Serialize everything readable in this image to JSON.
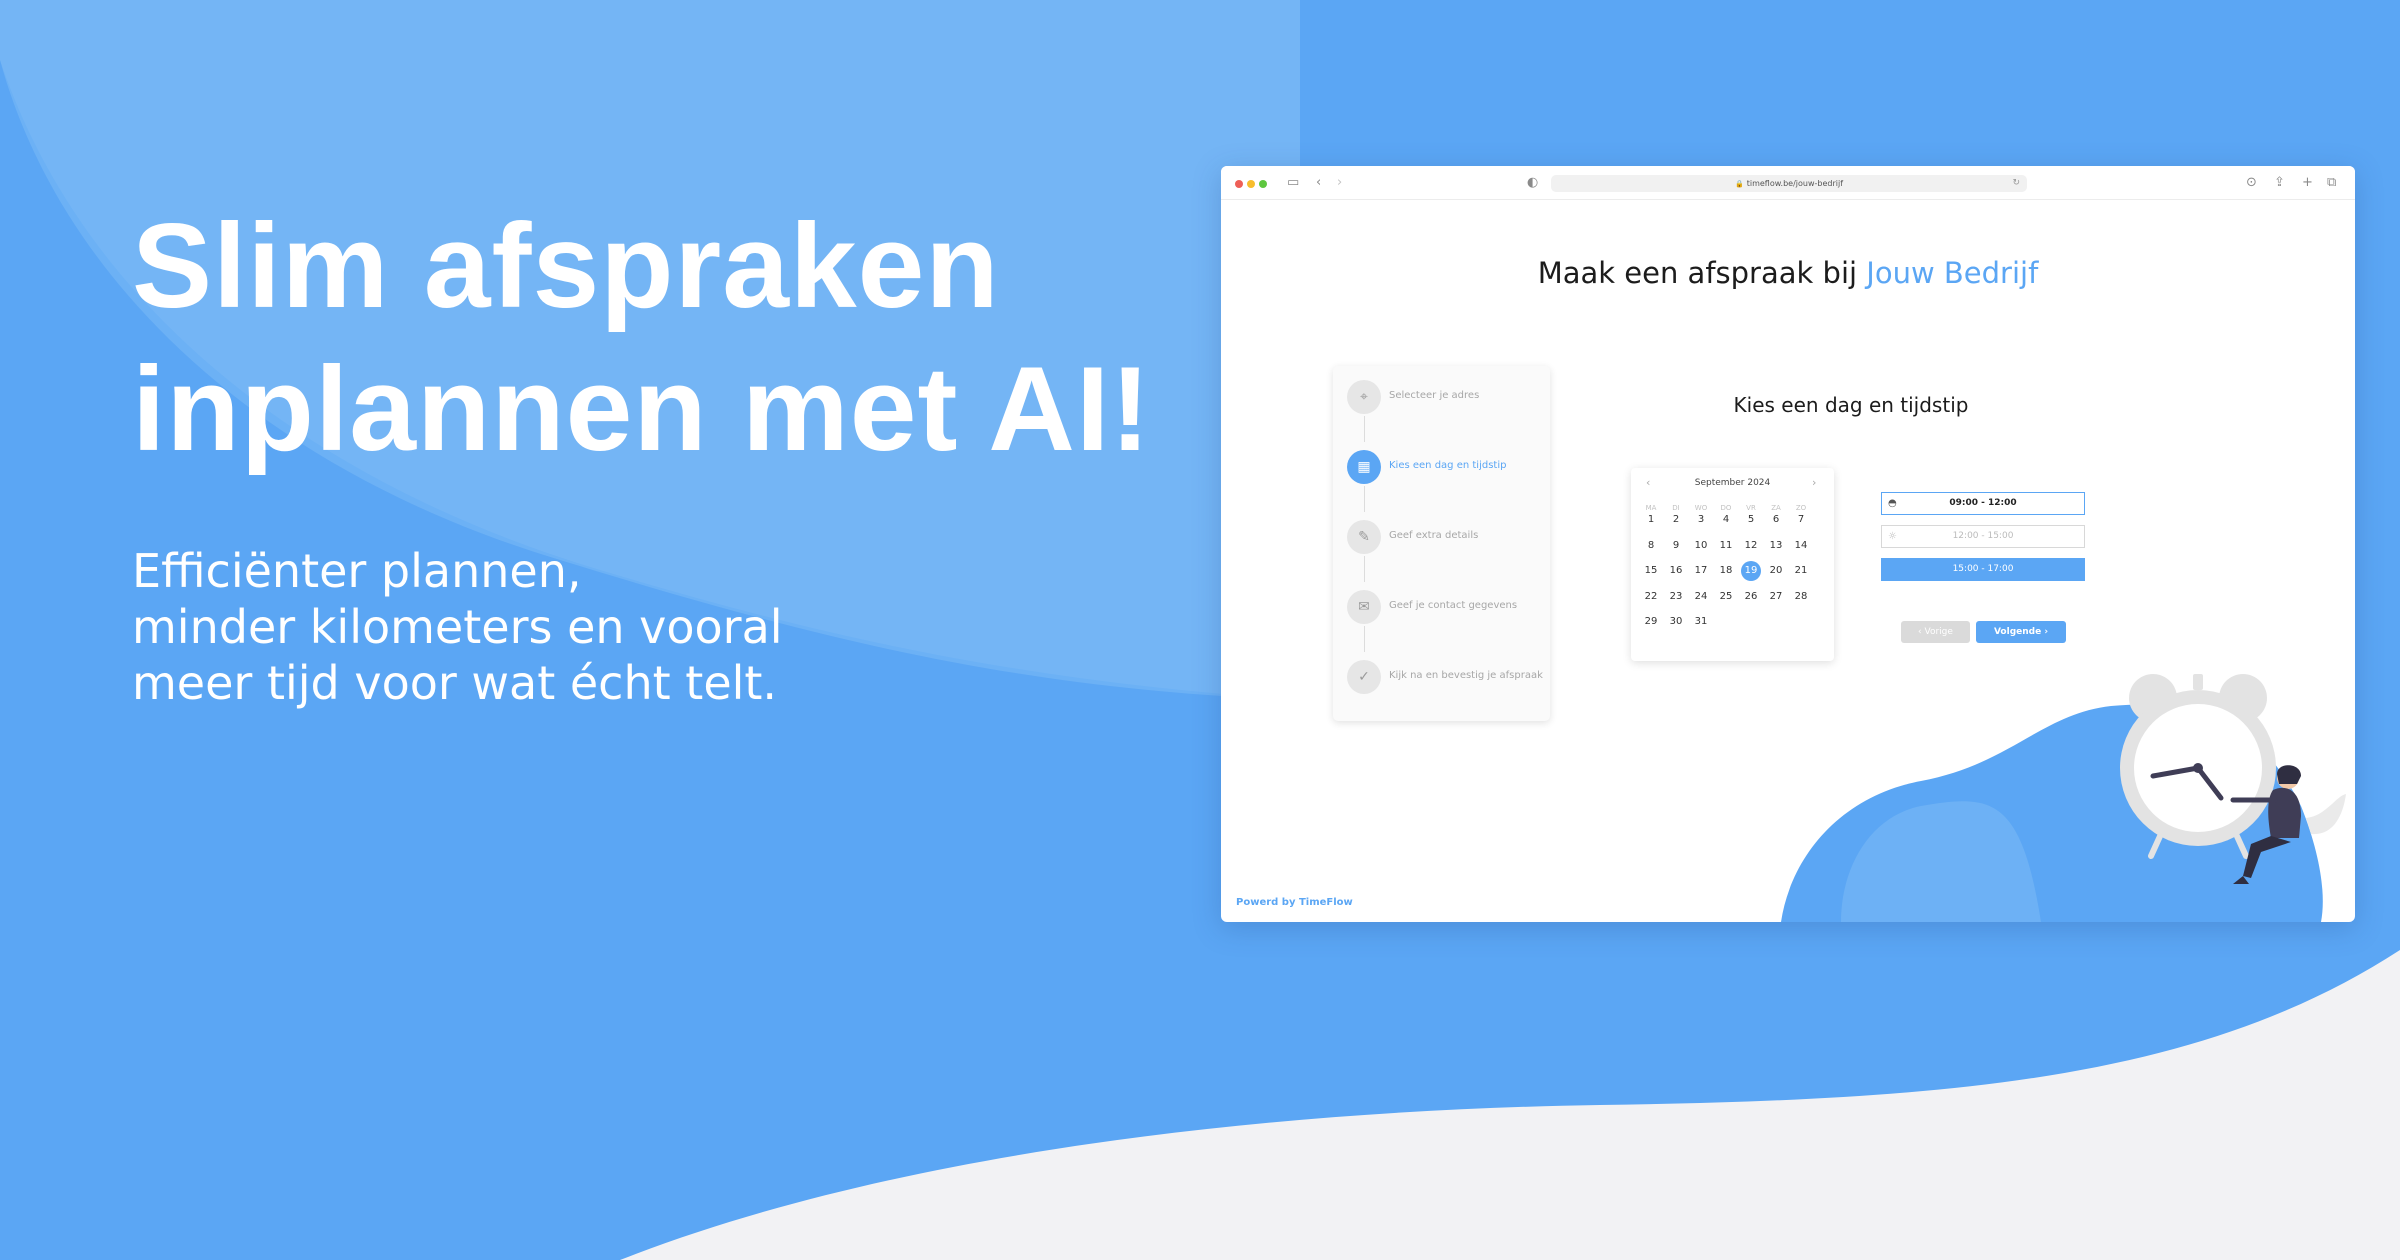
{
  "hero": {
    "title_line1": "Slim afspraken",
    "title_line2": "inplannen met AI!",
    "subtitle_line1": "Efficiënter plannen,",
    "subtitle_line2": "minder kilometers en vooral",
    "subtitle_line3": "meer tijd voor wat écht telt."
  },
  "browser": {
    "url": "timeflow.be/jouw-bedrijf",
    "page_title_prefix": "Maak een afspraak bij",
    "page_title_brand": "Jouw Bedrijf",
    "section_title": "Kies een dag en tijdstip",
    "powered_by": "Powerd by TimeFlow"
  },
  "steps": [
    {
      "label": "Selecteer je adres",
      "icon": "location-pin-icon",
      "active": false
    },
    {
      "label": "Kies een dag en tijdstip",
      "icon": "calendar-icon",
      "active": true
    },
    {
      "label": "Geef extra details",
      "icon": "edit-note-icon",
      "active": false
    },
    {
      "label": "Geef je contact gegevens",
      "icon": "contact-card-icon",
      "active": false
    },
    {
      "label": "Kijk na en bevestig je afspraak",
      "icon": "check-circle-icon",
      "active": false
    }
  ],
  "calendar": {
    "month_label": "September 2024",
    "weekdays": [
      "MA",
      "DI",
      "WO",
      "DO",
      "VR",
      "ZA",
      "ZO"
    ],
    "weeks": [
      [
        "1",
        "2",
        "3",
        "4",
        "5",
        "6",
        "7"
      ],
      [
        "8",
        "9",
        "10",
        "11",
        "12",
        "13",
        "14"
      ],
      [
        "15",
        "16",
        "17",
        "18",
        "19",
        "20",
        "21"
      ],
      [
        "22",
        "23",
        "24",
        "25",
        "26",
        "27",
        "28"
      ],
      [
        "29",
        "30",
        "31",
        "",
        "",
        "",
        ""
      ]
    ],
    "selected_day": "19"
  },
  "time_slots": [
    {
      "label": "09:00 - 12:00",
      "state": "selected-outline",
      "icon": "sunrise-icon"
    },
    {
      "label": "12:00 - 15:00",
      "state": "disabled",
      "icon": "sun-icon"
    },
    {
      "label": "15:00 - 17:00",
      "state": "filled",
      "icon": ""
    }
  ],
  "buttons": {
    "prev_label": "Vorige",
    "next_label": "Volgende"
  },
  "colors": {
    "accent": "#5ba6f4",
    "background_light": "#f2f2f4"
  }
}
